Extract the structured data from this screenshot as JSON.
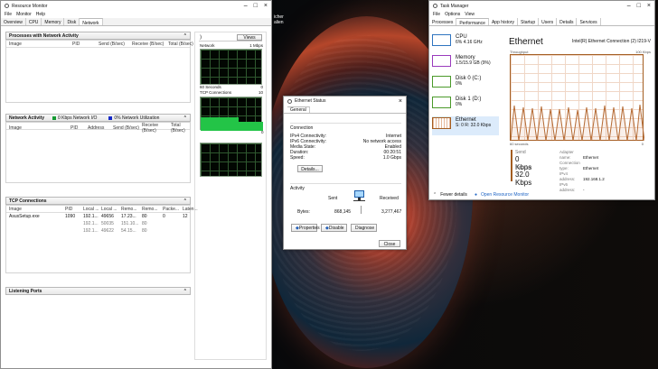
{
  "resource_monitor": {
    "title": "Resource Monitor",
    "menu": [
      "File",
      "Monitor",
      "Help"
    ],
    "tabs": [
      "Overview",
      "CPU",
      "Memory",
      "Disk",
      "Network"
    ],
    "processes": {
      "title": "Processes with Network Activity",
      "columns": [
        "Image",
        "PID",
        "Send (B/sec)",
        "Receive (B/sec)",
        "Total (B/sec)"
      ]
    },
    "network_activity": {
      "title": "Network Activity",
      "io": "0 Kbps Network I/O",
      "util": "0% Network Utilization",
      "columns": [
        "Image",
        "PID",
        "Address",
        "Send (B/sec)",
        "Receive (B/sec)",
        "Total (B/sec)"
      ]
    },
    "tcp": {
      "title": "TCP Connections",
      "columns": [
        "Image",
        "PID",
        "Local ...",
        "Local ...",
        "Remo...",
        "Remo...",
        "Packe...",
        "Laten..."
      ],
      "rows": [
        [
          "AsusSetup.exe",
          "1090",
          "192.1...",
          "49656",
          "17.23...",
          "80",
          "0",
          "12"
        ],
        [
          "",
          "",
          "192.1...",
          "50035",
          "151.10...",
          "80",
          "",
          ""
        ],
        [
          "",
          "",
          "192.1...",
          "49622",
          "54.15...",
          "80",
          "",
          ""
        ]
      ]
    },
    "listening": {
      "title": "Listening Ports"
    },
    "right": {
      "views": "Views",
      "network_label": "Network",
      "network_value": "1 Mbps",
      "seconds": "60 Seconds",
      "network_zero": "0",
      "tcp_label": "TCP Connections",
      "tcp_value": "10",
      "tcp_zero": "0"
    }
  },
  "ethernet_status": {
    "title": "Ethernet Status",
    "tab": "General",
    "connection_title": "Connection",
    "rows": [
      [
        "IPv4 Connectivity:",
        "Internet"
      ],
      [
        "IPv6 Connectivity:",
        "No network access"
      ],
      [
        "Media State:",
        "Enabled"
      ],
      [
        "Duration:",
        "00:20:51"
      ],
      [
        "Speed:",
        "1.0 Gbps"
      ]
    ],
    "details": "Details...",
    "activity_title": "Activity",
    "sent": "Sent",
    "received": "Received",
    "bytes_label": "Bytes:",
    "bytes_sent": "868,145",
    "bytes_received": "3,277,467",
    "buttons": [
      "Properties",
      "Disable",
      "Diagnose"
    ],
    "close": "Close"
  },
  "task_manager": {
    "title": "Task Manager",
    "menu": [
      "File",
      "Options",
      "View"
    ],
    "tabs": [
      "Processes",
      "Performance",
      "App history",
      "Startup",
      "Users",
      "Details",
      "Services"
    ],
    "sidebar": [
      {
        "name": "CPU",
        "value": "6% 4.16 GHz"
      },
      {
        "name": "Memory",
        "value": "1.5/15.9 GB (9%)"
      },
      {
        "name": "Disk 0 (C:)",
        "value": "0%"
      },
      {
        "name": "Disk 1 (D:)",
        "value": "0%"
      },
      {
        "name": "Ethernet",
        "value": "S: 0 R: 32.0 Kbps"
      }
    ],
    "ethernet": "Ethernet",
    "adapter": "Intel(R) Ethernet Connection (2) I219-V",
    "throughput": "Throughput",
    "max": "100 Kbps",
    "seconds": "60 seconds",
    "zero": "0",
    "send_label": "Send",
    "send_value": "0 Kbps",
    "receive_label": "Receive",
    "receive_value": "32.0 Kbps",
    "details": [
      [
        "Adapter name:",
        "Ethernet"
      ],
      [
        "Connection type:",
        "Ethernet"
      ],
      [
        "IPv4 address:",
        "192.168.1.2"
      ],
      [
        "IPv6 address:",
        "-"
      ]
    ],
    "fewer": "Fewer details",
    "open_rm": "Open Resource Monitor"
  },
  "desktop_text": "icher\nalien"
}
